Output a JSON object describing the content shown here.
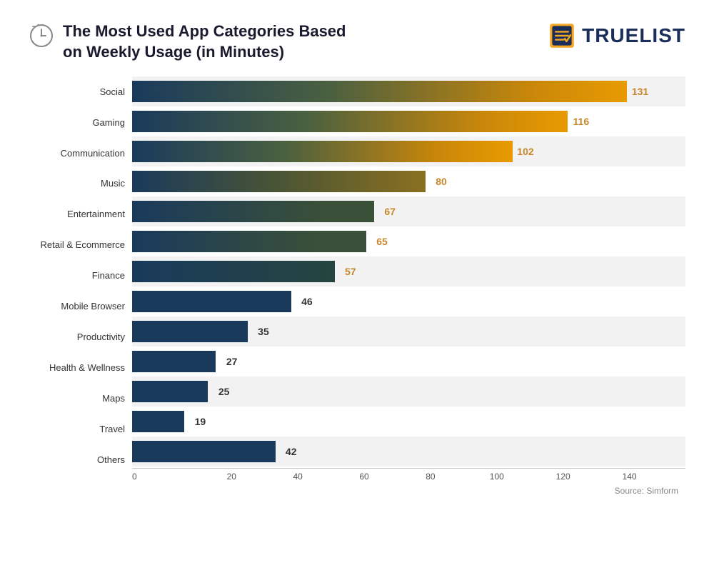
{
  "header": {
    "title_line1": "The Most Used App Categories Based",
    "title_line2": "on Weekly Usage (in Minutes)",
    "logo_text": "TRUELIST",
    "source": "Source: Simform"
  },
  "chart": {
    "max_value": 140,
    "x_labels": [
      "0",
      "20",
      "40",
      "60",
      "80",
      "100",
      "120",
      "140"
    ],
    "bars": [
      {
        "label": "Social",
        "value": 131,
        "color_start": "#1a3a5c",
        "color_end": "#d4930a"
      },
      {
        "label": "Gaming",
        "value": 116,
        "color_start": "#1a3a5c",
        "color_end": "#c08818"
      },
      {
        "label": "Communication",
        "value": 102,
        "color_start": "#1a3a5c",
        "color_end": "#a07520"
      },
      {
        "label": "Music",
        "value": 80,
        "color_start": "#1a3a5c",
        "color_end": "#707028"
      },
      {
        "label": "Entertainment",
        "value": 67,
        "color_start": "#1a3a5c",
        "color_end": "#4a5535"
      },
      {
        "label": "Retail & Ecommerce",
        "value": 65,
        "color_start": "#1a3a5c",
        "color_end": "#3a5038"
      },
      {
        "label": "Finance",
        "value": 57,
        "color_start": "#1a3a5c",
        "color_end": "#254540"
      },
      {
        "label": "Mobile Browser",
        "value": 46,
        "color_start": "#1a3a5c",
        "color_end": "#1e3d4a"
      },
      {
        "label": "Productivity",
        "value": 35,
        "color_start": "#1a3a5c",
        "color_end": "#1a3a5c"
      },
      {
        "label": "Health & Wellness",
        "value": 27,
        "color_start": "#1a3a5c",
        "color_end": "#1a3a5c"
      },
      {
        "label": "Maps",
        "value": 25,
        "color_start": "#1a3a5c",
        "color_end": "#1a3a5c"
      },
      {
        "label": "Travel",
        "value": 19,
        "color_start": "#1a3a5c",
        "color_end": "#1a3a5c"
      },
      {
        "label": "Others",
        "value": 42,
        "color_start": "#1a3a5c",
        "color_end": "#1a3a5c"
      }
    ]
  }
}
